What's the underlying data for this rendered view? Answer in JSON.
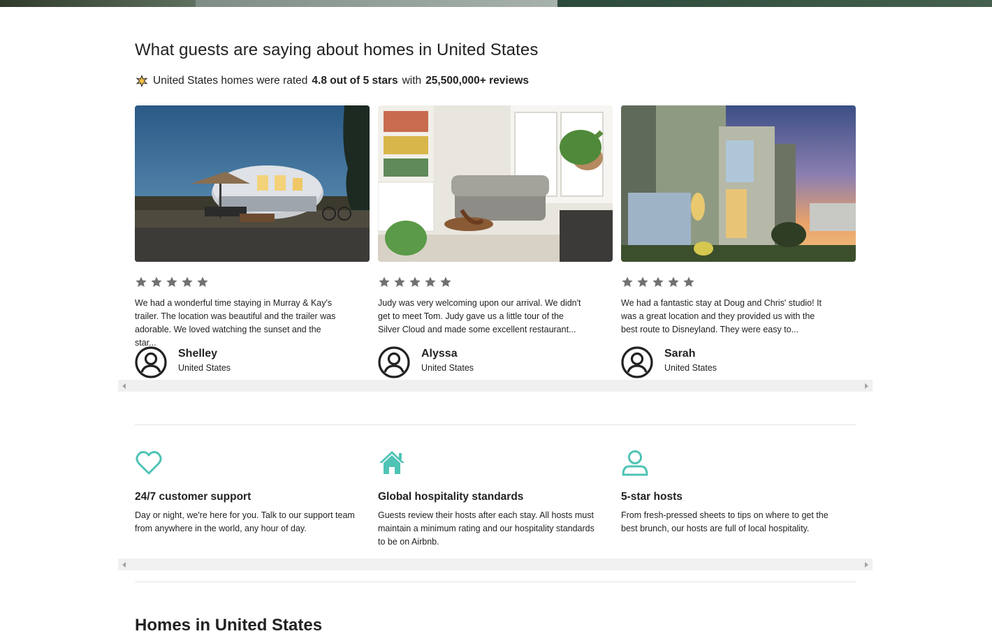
{
  "reviews_section": {
    "title": "What guests are saying about homes in United States",
    "rating_prefix": "United States homes were rated",
    "rating_value": "4.8 out of 5 stars",
    "rating_middle": "with",
    "review_count": "25,500,000+ reviews"
  },
  "reviews": [
    {
      "stars": 5,
      "text": "We had a wonderful time staying in Murray & Kay's trailer. The location was beautiful and the trailer was adorable. We loved watching the sunset and the star...",
      "name": "Shelley",
      "country": "United States"
    },
    {
      "stars": 5,
      "text": "Judy was very welcoming upon our arrival. We didn't get to meet Tom. Judy gave us a little tour of the Silver Cloud and made some excellent restaurant...",
      "name": "Alyssa",
      "country": "United States"
    },
    {
      "stars": 5,
      "text": "We had a fantastic stay at Doug and Chris' studio! It was a great location and they provided us with the best route to Disneyland. They were easy to...",
      "name": "Sarah",
      "country": "United States"
    }
  ],
  "features": [
    {
      "icon": "heart-icon",
      "title": "24/7 customer support",
      "description": "Day or night, we're here for you. Talk to our support team from anywhere in the world, any hour of day."
    },
    {
      "icon": "house-icon",
      "title": "Global hospitality standards",
      "description": "Guests review their hosts after each stay. All hosts must maintain a minimum rating and our hospitality standards to be on Airbnb."
    },
    {
      "icon": "person-icon",
      "title": "5-star hosts",
      "description": "From fresh-pressed sheets to tips on where to get the best brunch, our hosts are full of local hospitality."
    }
  ],
  "homes_section": {
    "title": "Homes in United States"
  },
  "colors": {
    "accent_teal": "#4fc3b5",
    "star_gray": "#717171",
    "text": "#222222"
  }
}
